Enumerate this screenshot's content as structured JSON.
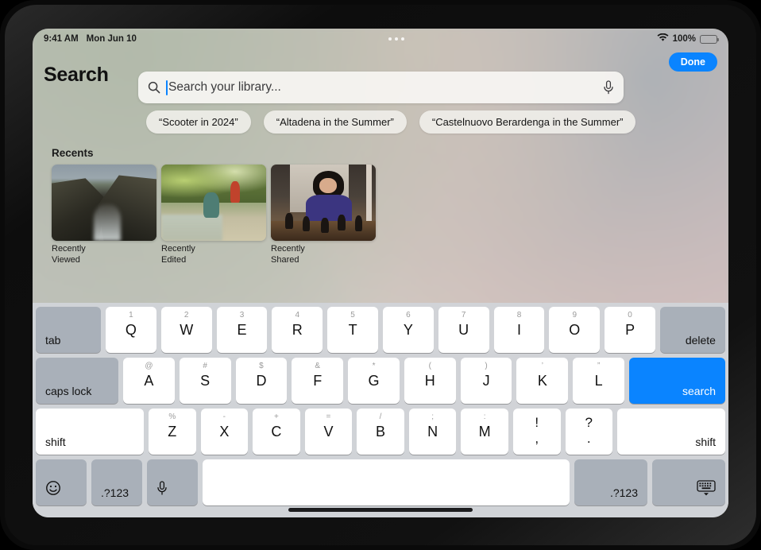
{
  "status_bar": {
    "time": "9:41 AM",
    "date": "Mon Jun 10",
    "battery_percent": "100%",
    "wifi_icon": "wifi-icon",
    "battery_icon": "battery-icon",
    "multitask_icon": "multitasking-dots-icon"
  },
  "header": {
    "title": "Search",
    "done_label": "Done"
  },
  "search": {
    "placeholder": "Search your library...",
    "value": "",
    "search_icon": "search-icon",
    "mic_icon": "microphone-icon"
  },
  "suggestions": [
    {
      "label": "“Scooter in 2024”"
    },
    {
      "label": "“Altadena in the Summer”"
    },
    {
      "label": "“Castelnuovo Berardenga in the Summer”"
    }
  ],
  "recents": {
    "title": "Recents",
    "items": [
      {
        "label": "Recently\nViewed",
        "thumb": "coastal-cliffs-photo"
      },
      {
        "label": "Recently\nEdited",
        "thumb": "creek-hikers-photo"
      },
      {
        "label": "Recently\nShared",
        "thumb": "girl-playing-chess-photo"
      }
    ]
  },
  "keyboard": {
    "rows": [
      [
        {
          "main": "tab",
          "style": "mod gray"
        },
        {
          "main": "Q",
          "sub": "1"
        },
        {
          "main": "W",
          "sub": "2"
        },
        {
          "main": "E",
          "sub": "3"
        },
        {
          "main": "R",
          "sub": "4"
        },
        {
          "main": "T",
          "sub": "5"
        },
        {
          "main": "Y",
          "sub": "6"
        },
        {
          "main": "U",
          "sub": "7"
        },
        {
          "main": "I",
          "sub": "8"
        },
        {
          "main": "O",
          "sub": "9"
        },
        {
          "main": "P",
          "sub": "0"
        },
        {
          "main": "delete",
          "style": "mod right gray"
        }
      ],
      [
        {
          "main": "caps lock",
          "style": "mod gray"
        },
        {
          "main": "A",
          "sub": "@"
        },
        {
          "main": "S",
          "sub": "#"
        },
        {
          "main": "D",
          "sub": "$"
        },
        {
          "main": "F",
          "sub": "&"
        },
        {
          "main": "G",
          "sub": "*"
        },
        {
          "main": "H",
          "sub": "("
        },
        {
          "main": "J",
          "sub": ")"
        },
        {
          "main": "K",
          "sub": "’"
        },
        {
          "main": "L",
          "sub": "”"
        },
        {
          "main": "search",
          "style": "mod right blue"
        }
      ],
      [
        {
          "main": "shift",
          "style": "mod"
        },
        {
          "main": "Z",
          "sub": "%"
        },
        {
          "main": "X",
          "sub": "-"
        },
        {
          "main": "C",
          "sub": "+"
        },
        {
          "main": "V",
          "sub": "="
        },
        {
          "main": "B",
          "sub": "/"
        },
        {
          "main": "N",
          "sub": ";"
        },
        {
          "main": "M",
          "sub": ":"
        },
        {
          "main": ",",
          "sub": "!",
          "style": "dual"
        },
        {
          "main": ".",
          "sub": "?",
          "style": "dual"
        },
        {
          "main": "shift",
          "style": "mod right"
        }
      ],
      [
        {
          "icon": "emoji-icon",
          "style": "gray icon-key left"
        },
        {
          "main": ".?123",
          "style": "mod gray"
        },
        {
          "icon": "microphone-icon",
          "style": "gray icon-key left"
        },
        {
          "main": "",
          "style": "spacebar"
        },
        {
          "main": ".?123",
          "style": "mod right gray"
        },
        {
          "icon": "dismiss-keyboard-icon",
          "style": "gray icon-key right"
        }
      ]
    ]
  },
  "colors": {
    "accent_blue": "#0a84ff",
    "key_white": "#ffffff",
    "key_gray": "#a9b0b9",
    "keyboard_bg": "#d1d4d8"
  }
}
